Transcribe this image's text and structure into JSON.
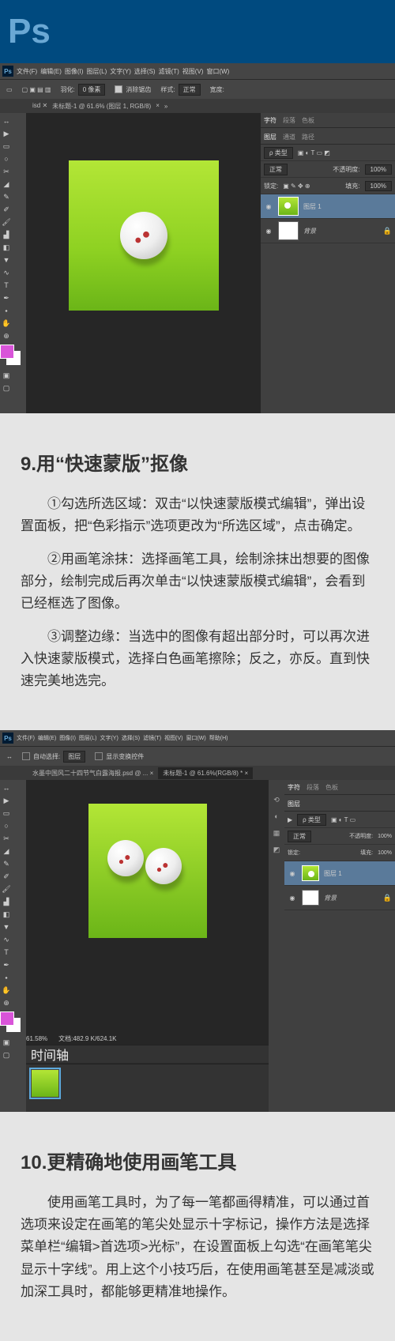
{
  "header": {
    "logo": "Ps"
  },
  "ps1": {
    "menu": [
      "文件(F)",
      "编辑(E)",
      "图像(I)",
      "图层(L)",
      "文字(Y)",
      "选择(S)",
      "滤镜(T)",
      "视图(V)",
      "窗口(W)"
    ],
    "opt": {
      "feather_lbl": "羽化:",
      "feather_val": "0 像素",
      "aa": "消除锯齿",
      "style_lbl": "样式:",
      "style_val": "正常",
      "width_lbl": "宽度:"
    },
    "tab": {
      "name": "未标题-1 @ 61.6% (图层 1, RGB/8)",
      "close": "×",
      "other": "»"
    },
    "panels": {
      "p1_tabs": [
        "字符",
        "段落",
        "色板"
      ],
      "p2_tabs": [
        "图层",
        "通道",
        "路径"
      ],
      "kind_lbl": "ρ 类型",
      "blend": "正常",
      "opacity_lbl": "不透明度:",
      "opacity": "100%",
      "lock_lbl": "锁定:",
      "lock_icons": "▣ ✎ ✥ ⊕",
      "fill_lbl": "填充:",
      "fill": "100%",
      "layer1": "图层 1",
      "bg": "背景"
    }
  },
  "sec9": {
    "title": "9.用“快速蒙版”抠像",
    "p1": "①勾选所选区域：双击“以快速蒙版模式编辑”，弹出设置面板，把“色彩指示”选项更改为“所选区域”，点击确定。",
    "p2": "②用画笔涂抹：选择画笔工具，绘制涂抹出想要的图像部分，绘制完成后再次单击“以快速蒙版模式编辑”，会看到已经框选了图像。",
    "p3": "③调整边缘：当选中的图像有超出部分时，可以再次进入快速蒙版模式，选择白色画笔擦除；反之，亦反。直到快速完美地选完。"
  },
  "ps2": {
    "menu": [
      "文件(F)",
      "编辑(E)",
      "图像(I)",
      "图层(L)",
      "文字(Y)",
      "选择(S)",
      "滤镜(T)",
      "视图(V)",
      "窗口(W)",
      "帮助(H)"
    ],
    "opt": {
      "auto": "自动选择:",
      "group": "图层",
      "transform": "显示变换控件"
    },
    "tab1": "水墨中国风二十四节气白露海报.psd @ ... ×",
    "tab2": "未标题-1 @ 61.6%(RGB/8) * ×",
    "status": {
      "zoom": "61.58%",
      "doc": "文档:482.9 K/624.1K"
    },
    "timeline": "时间轴",
    "panels": {
      "p1_tabs": [
        "字符",
        "段落",
        "色板"
      ],
      "p2_tabs": [
        "图层"
      ],
      "kind": "ρ 类型",
      "blend": "正常",
      "opacity_lbl": "不透明度:",
      "opacity": "100%",
      "lock": "锁定:",
      "fill_lbl": "填充:",
      "fill": "100%",
      "layer1": "图层 1",
      "bg": "背景"
    }
  },
  "sec10": {
    "title": "10.更精确地使用画笔工具",
    "p1": "使用画笔工具时，为了每一笔都画得精准，可以通过首选项来设定在画笔的笔尖处显示十字标记，操作方法是选择菜单栏“编辑>首选项>光标”，在设置面板上勾选“在画笔笔尖显示十字线”。用上这个小技巧后，在使用画笔甚至是减淡或加深工具时，都能够更精准地操作。"
  }
}
